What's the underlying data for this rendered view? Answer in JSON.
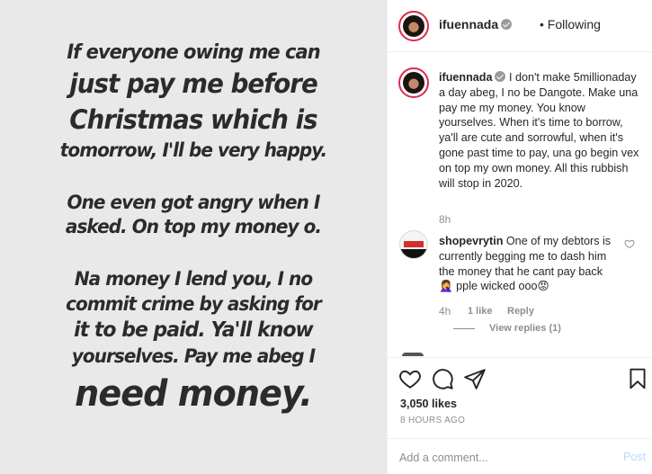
{
  "image_text": {
    "lines": [
      "If everyone owing me can",
      "just pay me before",
      "Christmas which is",
      "tomorrow, I'll be very happy.",
      "One  even got angry when I",
      "asked. On top my money o.",
      "Na money I lend you, I no",
      "commit crime by asking for",
      "it to be paid. Ya'll know",
      "yourselves. Pay me abeg I",
      "need money."
    ]
  },
  "header": {
    "username": "ifuennada",
    "separator": "•",
    "follow_status": "Following"
  },
  "caption": {
    "username": "ifuennada",
    "text": "I don't make 5millionaday a day abeg, I no be Dangote. Make una pay me my money. You know yourselves. When it's time to borrow, ya'll are cute and sorrowful, when it's gone past time to pay, una go begin vex on top my own money. All this rubbish will stop in 2020.",
    "time": "8h"
  },
  "comment": {
    "username": "shopevrytin",
    "text": "One of my debtors is currently begging me to dash him the money that he cant pay back 🤦‍♀️ pple wicked ooo😡",
    "time": "4h",
    "likes": "1 like",
    "reply": "Reply",
    "view_replies": "View replies (1)"
  },
  "actions": {
    "likes": "3,050 likes",
    "posted_ago": "8 HOURS AGO"
  },
  "add_comment": {
    "placeholder": "Add a comment...",
    "post_label": "Post"
  },
  "colors": {
    "avatar_ring": "#e0294a",
    "muted_text": "#8e8e8e",
    "post_button_disabled": "#b3dbff"
  }
}
